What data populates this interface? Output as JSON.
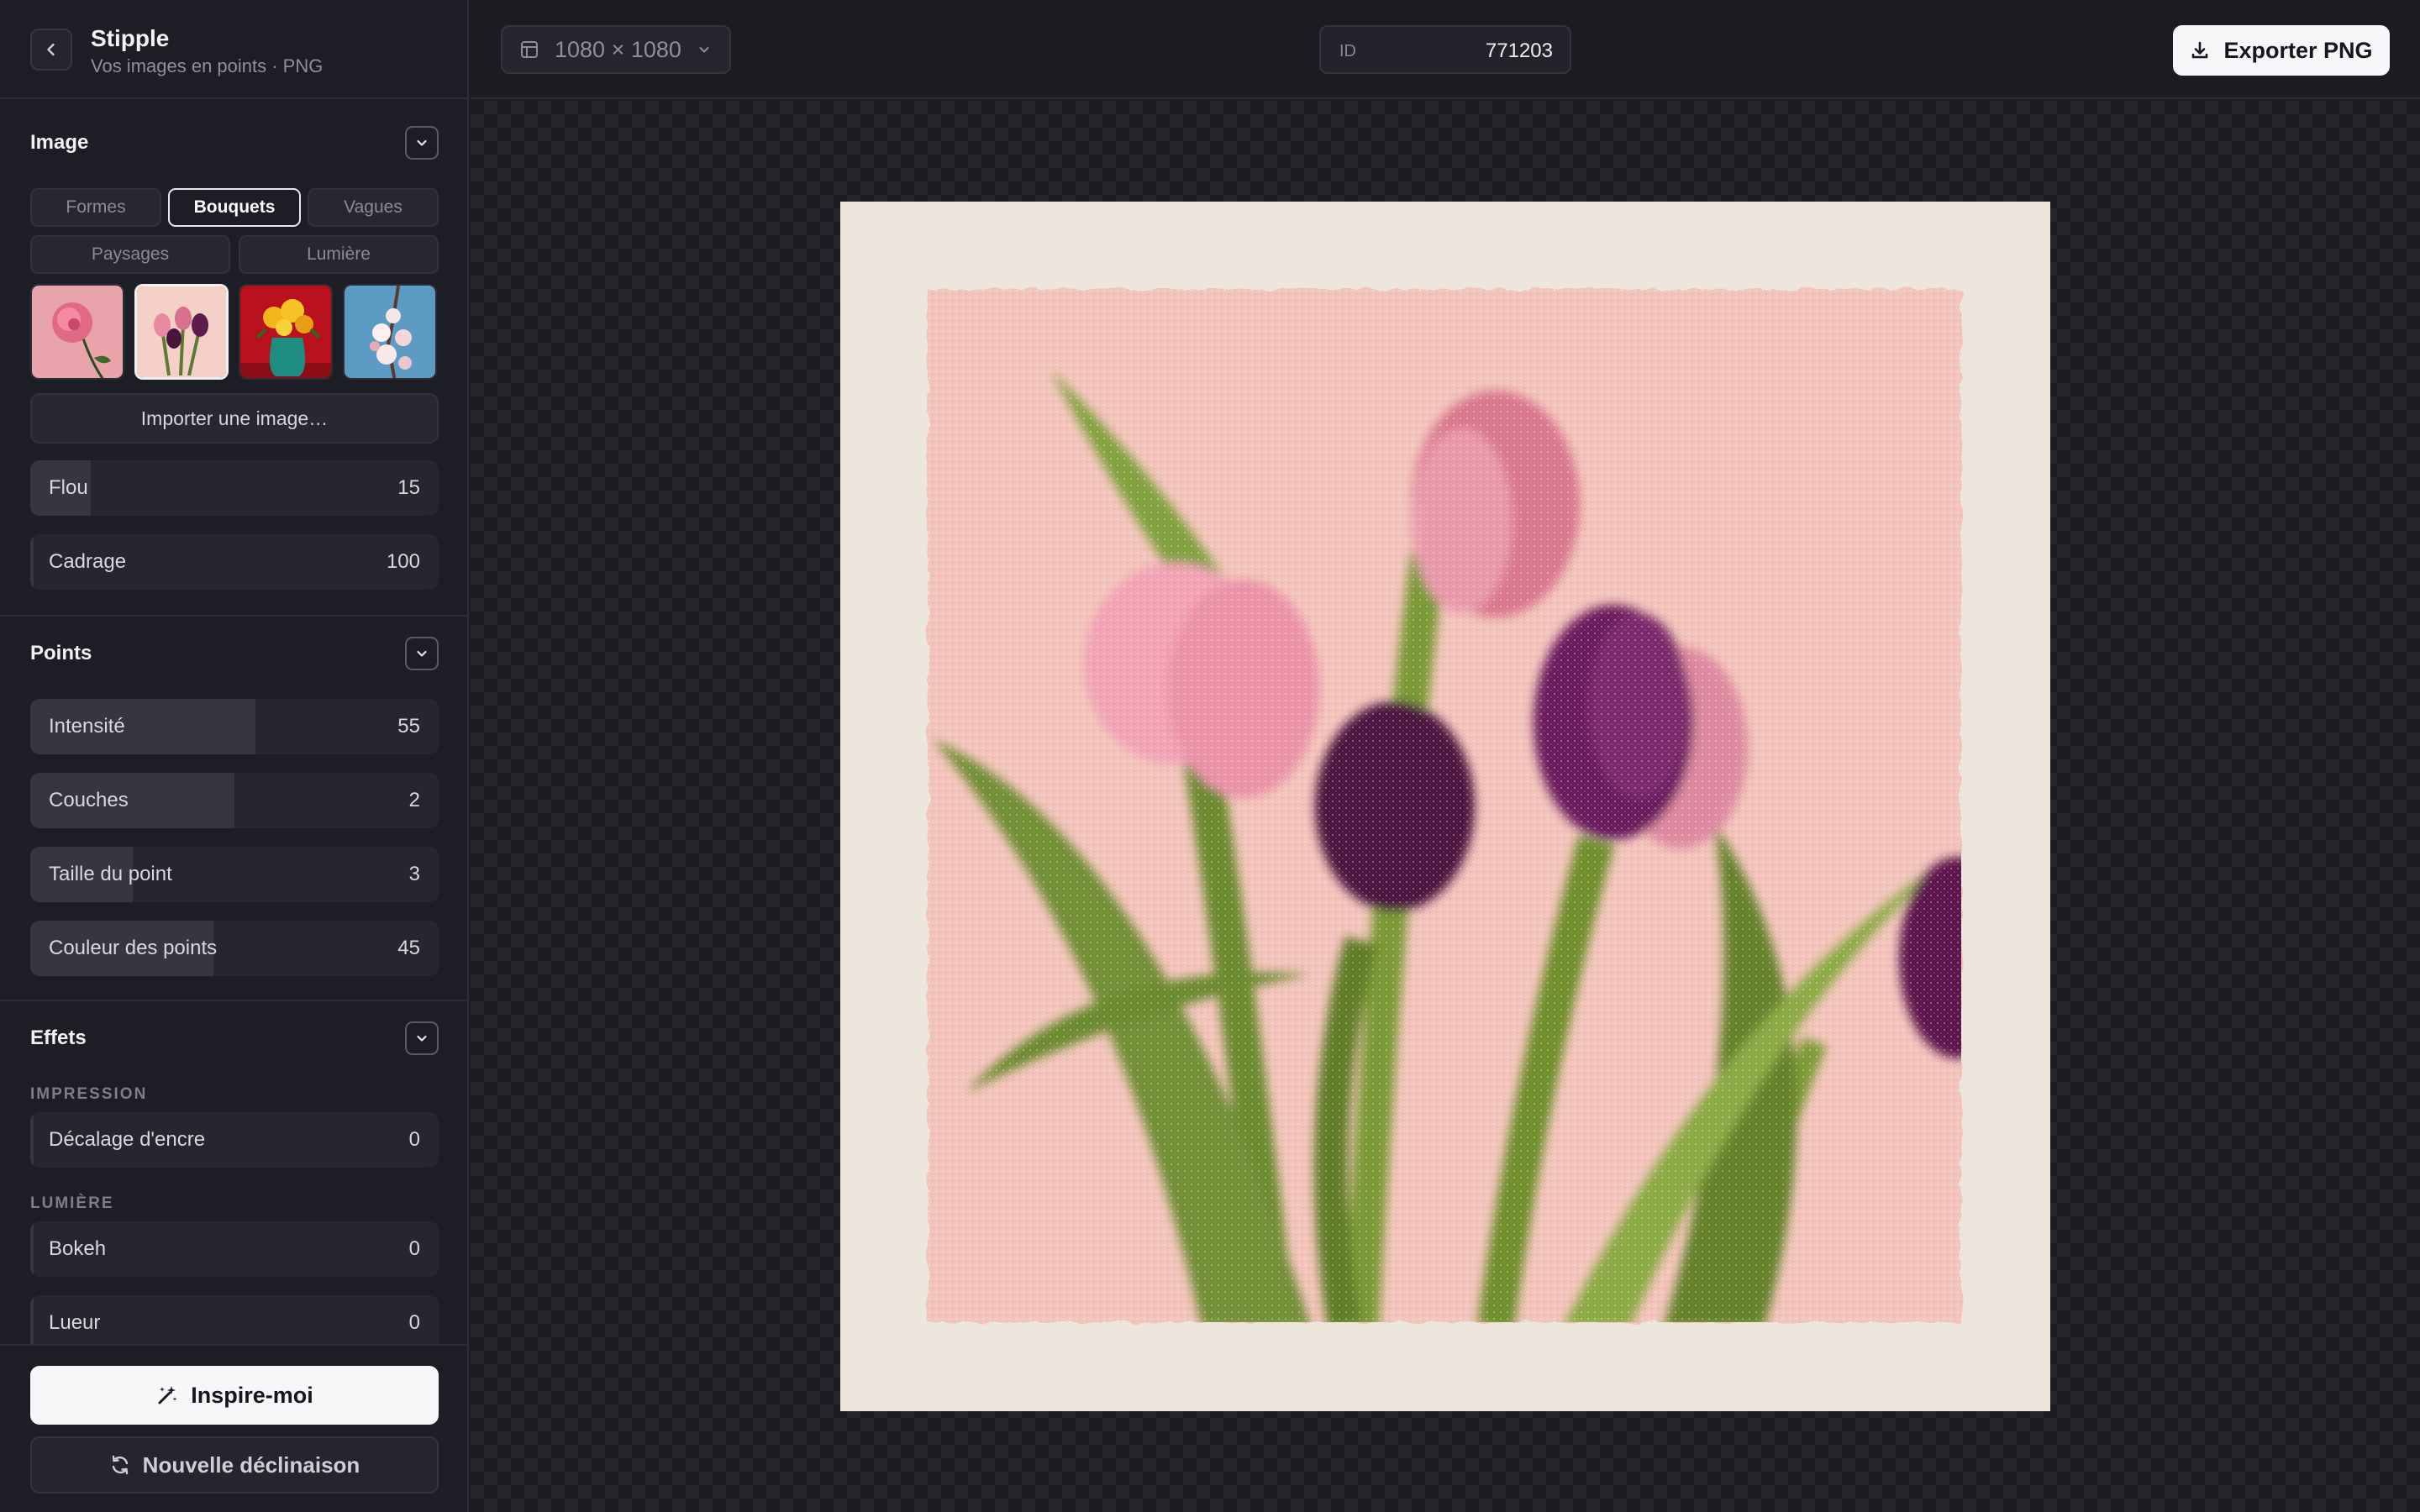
{
  "app": {
    "title": "Stipple",
    "subtitle": "Vos images en points · PNG"
  },
  "sections": {
    "image": {
      "title": "Image",
      "tabs": [
        {
          "label": "Formes",
          "active": false
        },
        {
          "label": "Bouquets",
          "active": true
        },
        {
          "label": "Vagues",
          "active": false
        },
        {
          "label": "Paysages",
          "active": false
        },
        {
          "label": "Lumière",
          "active": false
        }
      ],
      "thumbnails": [
        {
          "name": "rose",
          "selected": false
        },
        {
          "name": "tulipes",
          "selected": true
        },
        {
          "name": "vase-jaune",
          "selected": false
        },
        {
          "name": "fleurs-cerisier",
          "selected": false
        }
      ],
      "import_label": "Importer une image…",
      "sliders": [
        {
          "label": "Flou",
          "value": "15",
          "fraction": 0.15
        },
        {
          "label": "Cadrage",
          "value": "100",
          "fraction": 0.0
        }
      ]
    },
    "points": {
      "title": "Points",
      "sliders": [
        {
          "label": "Intensité",
          "value": "55",
          "fraction": 0.55
        },
        {
          "label": "Couches",
          "value": "2",
          "fraction": 0.5
        },
        {
          "label": "Taille du point",
          "value": "3",
          "fraction": 0.25
        },
        {
          "label": "Couleur des points",
          "value": "45",
          "fraction": 0.45
        }
      ]
    },
    "effets": {
      "title": "Effets",
      "impression_label": "IMPRESSION",
      "impression_sliders": [
        {
          "label": "Décalage d'encre",
          "value": "0",
          "fraction": 0.0
        }
      ],
      "lumiere_label": "LUMIÈRE",
      "lumiere_sliders": [
        {
          "label": "Bokeh",
          "value": "0",
          "fraction": 0.0
        },
        {
          "label": "Lueur",
          "value": "0",
          "fraction": 0.0
        }
      ]
    }
  },
  "footer": {
    "inspire_label": "Inspire-moi",
    "variant_label": "Nouvelle déclinaison"
  },
  "toolbar": {
    "size_label": "1080 × 1080",
    "id_key": "ID",
    "id_value": "771203",
    "export_label": "Exporter PNG"
  },
  "colors": {
    "background": "#1b1c22",
    "panel": "#1d1e25",
    "accent": "#f7f7f9",
    "artboard_border": "#ece6dc",
    "artwork_bg": "#f3c4bb"
  },
  "icons": {
    "back": "chevron-left-icon",
    "toggle": "chevron-down-icon",
    "size": "frame-icon",
    "export": "download-icon",
    "inspire": "magic-wand-icon",
    "variant": "refresh-icon"
  }
}
